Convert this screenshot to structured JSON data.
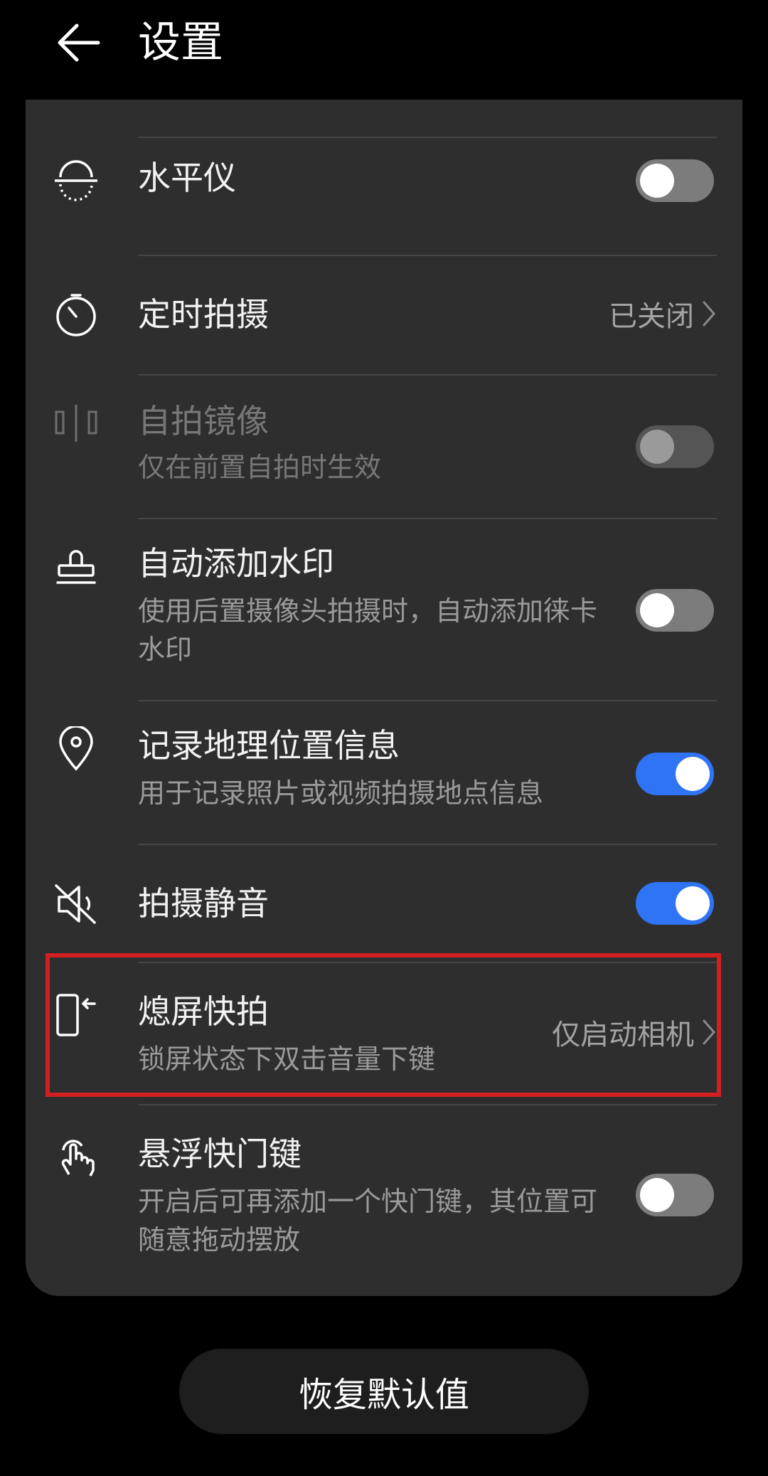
{
  "header": {
    "title": "设置"
  },
  "items": [
    {
      "title": "水平仪"
    },
    {
      "title": "定时拍摄",
      "value": "已关闭"
    },
    {
      "title": "自拍镜像",
      "subtitle": "仅在前置自拍时生效"
    },
    {
      "title": "自动添加水印",
      "subtitle": "使用后置摄像头拍摄时，自动添加徕卡水印"
    },
    {
      "title": "记录地理位置信息",
      "subtitle": "用于记录照片或视频拍摄地点信息"
    },
    {
      "title": "拍摄静音"
    },
    {
      "title": "熄屏快拍",
      "subtitle": "锁屏状态下双击音量下键",
      "value": "仅启动相机"
    },
    {
      "title": "悬浮快门键",
      "subtitle": "开启后可再添加一个快门键，其位置可随意拖动摆放"
    }
  ],
  "toggles": {
    "level": "off",
    "mirror": "disabled-off",
    "watermark": "off",
    "location": "on",
    "mute": "on",
    "floating_shutter": "off"
  },
  "reset_button": {
    "label": "恢复默认值"
  },
  "colors": {
    "accent": "#2f74f5",
    "highlight": "#d21f1f",
    "card": "#2e2e2e"
  }
}
